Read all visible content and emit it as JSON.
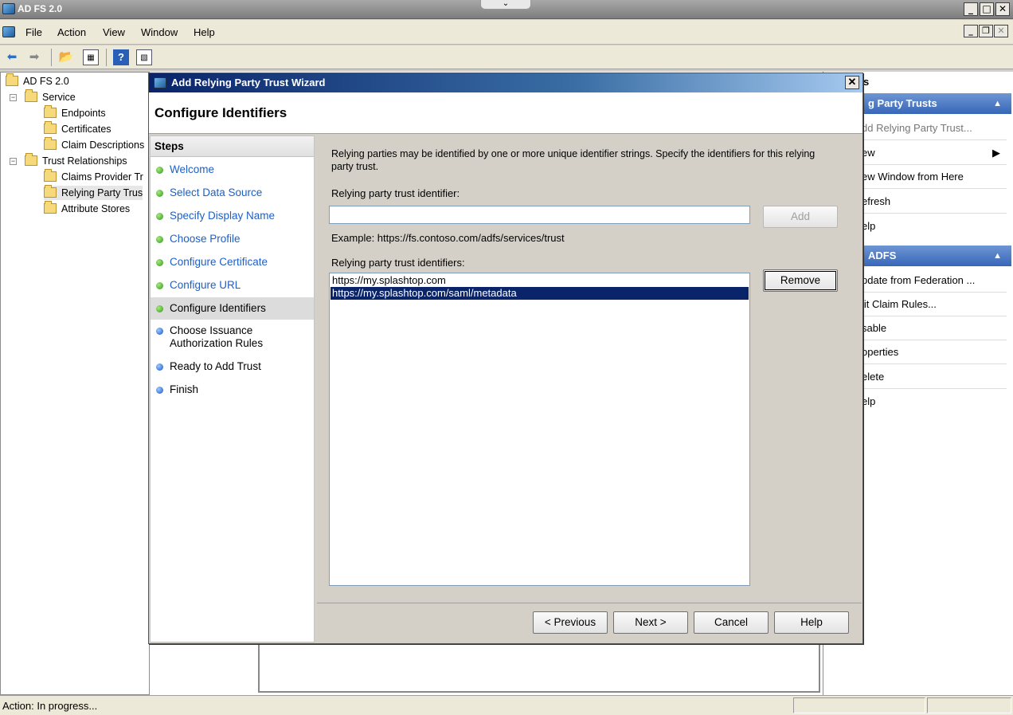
{
  "app": {
    "title": "AD FS 2.0",
    "menu": [
      "File",
      "Action",
      "View",
      "Window",
      "Help"
    ]
  },
  "tree": {
    "root": "AD FS 2.0",
    "service": "Service",
    "endpoints": "Endpoints",
    "certificates": "Certificates",
    "claim_descriptions": "Claim Descriptions",
    "trust_relationships": "Trust Relationships",
    "claims_provider": "Claims Provider Tr",
    "relying_party": "Relying Party Trus",
    "attribute_stores": "Attribute Stores"
  },
  "actions": {
    "header1": "g Party Trusts",
    "items1": [
      "dd Relying Party Trust...",
      "ew",
      "ew Window from Here",
      "efresh",
      "elp"
    ],
    "header2": "ADFS",
    "items2": [
      "pdate from Federation ...",
      "lit Claim Rules...",
      "sable",
      "operties",
      "elete",
      "elp"
    ],
    "pane_title": "s"
  },
  "status": {
    "text": "Action:  In progress..."
  },
  "wizard": {
    "title": "Add Relying Party Trust Wizard",
    "page_title": "Configure Identifiers",
    "steps_header": "Steps",
    "steps": [
      "Welcome",
      "Select Data Source",
      "Specify Display Name",
      "Choose Profile",
      "Configure Certificate",
      "Configure URL",
      "Configure Identifiers",
      "Choose Issuance Authorization Rules",
      "Ready to Add Trust",
      "Finish"
    ],
    "intro": "Relying parties may be identified by one or more unique identifier strings. Specify the identifiers for this relying party trust.",
    "identifier_label": "Relying party trust identifier:",
    "identifier_value": "",
    "add_button": "Add",
    "example": "Example: https://fs.contoso.com/adfs/services/trust",
    "identifiers_label": "Relying party trust identifiers:",
    "identifiers": [
      "https://my.splashtop.com",
      "https://my.splashtop.com/saml/metadata"
    ],
    "remove_button": "Remove",
    "previous_button": "< Previous",
    "next_button": "Next >",
    "cancel_button": "Cancel",
    "help_button": "Help"
  }
}
